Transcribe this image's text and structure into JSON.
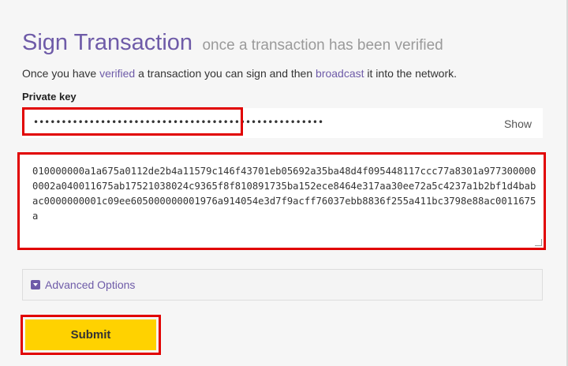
{
  "heading": {
    "title": "Sign Transaction",
    "subtitle": "once a transaction has been verified"
  },
  "intro": {
    "text_before": "Once you have ",
    "link_verified": "verified",
    "text_middle": " a transaction you can sign and then ",
    "link_broadcast": "broadcast",
    "text_after": " it into the network."
  },
  "private_key": {
    "label": "Private key",
    "masked_value": "••••••••••••••••••••••••••••••••••••••••••••••••••••",
    "show_label": "Show"
  },
  "transaction": {
    "raw_hex": "010000000a1a675a0112de2b4a11579c146f43701eb05692a35ba48d4f095448117ccc77a8301a9773000000002a040011675ab17521038024c9365f8f810891735ba152ece8464e317aa30ee72a5c4237a1b2bf1d4babac0000000001c09ee605000000001976a914054e3d7f9acff76037ebb8836f255a411bc3798e88ac0011675a"
  },
  "advanced_options": {
    "label": "Advanced Options",
    "icon": "chevron-down-square-icon"
  },
  "submit": {
    "label": "Submit"
  },
  "colors": {
    "accent": "#6e5ba8",
    "button": "#ffd200",
    "highlight": "#e10000",
    "background": "#f6f6f6"
  }
}
